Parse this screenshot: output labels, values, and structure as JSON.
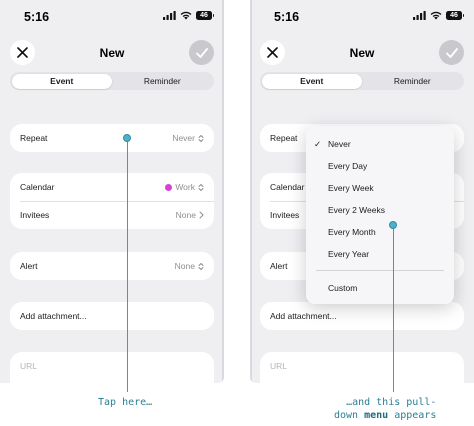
{
  "status": {
    "time": "5:16",
    "battery": "46"
  },
  "nav": {
    "title": "New"
  },
  "segments": [
    {
      "label": "Event",
      "active": true
    },
    {
      "label": "Reminder",
      "active": false
    }
  ],
  "form": {
    "repeat": {
      "label": "Repeat",
      "value": "Never"
    },
    "calendar": {
      "label": "Calendar",
      "value": "Work",
      "dot_color": "#d741d8"
    },
    "invitees": {
      "label": "Invitees",
      "value": "None"
    },
    "alert": {
      "label": "Alert",
      "value": "None"
    },
    "attachment": {
      "label": "Add attachment..."
    },
    "url": {
      "placeholder": "URL"
    }
  },
  "menu": {
    "items": [
      {
        "label": "Never",
        "checked": true
      },
      {
        "label": "Every Day",
        "checked": false
      },
      {
        "label": "Every Week",
        "checked": false
      },
      {
        "label": "Every 2 Weeks",
        "checked": false
      },
      {
        "label": "Every Month",
        "checked": false
      },
      {
        "label": "Every Year",
        "checked": false
      },
      {
        "label": "Custom",
        "checked": false
      }
    ]
  },
  "captions": {
    "left": "Tap here…",
    "right_line1": "…and this pull-",
    "right_line2_pre": "down ",
    "right_line2_bold": "menu",
    "right_line2_post": " appears"
  },
  "colors": {
    "accent": "#3d9db2",
    "background": "#efeff2"
  }
}
